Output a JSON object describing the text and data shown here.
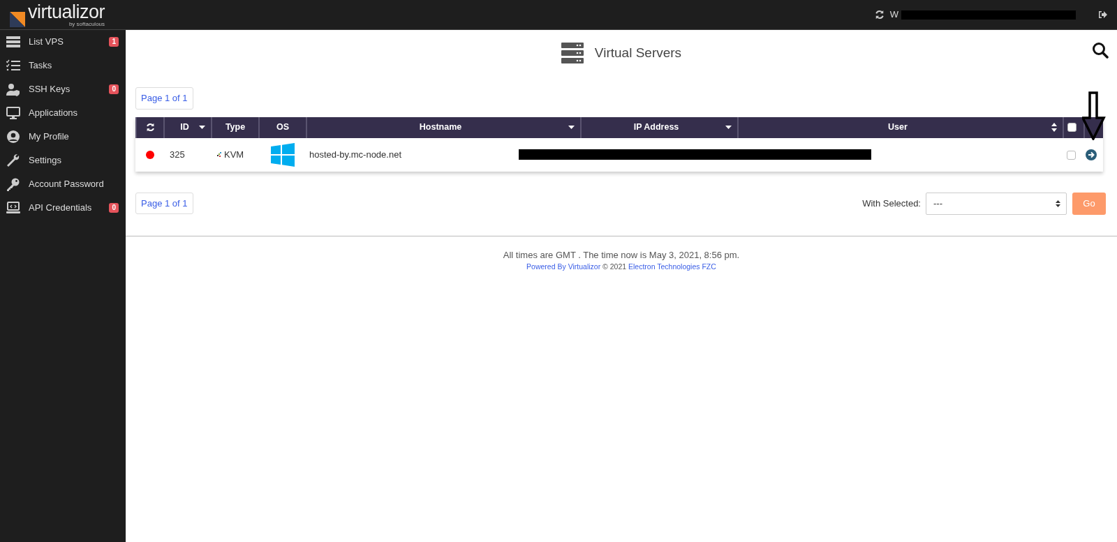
{
  "brand": {
    "name": "virtualizor",
    "tagline": "by softaculous"
  },
  "topbar": {
    "user_text": "W"
  },
  "sidebar": {
    "items": [
      {
        "label": "List VPS",
        "badge": "1"
      },
      {
        "label": "Tasks"
      },
      {
        "label": "SSH Keys",
        "badge": "0"
      },
      {
        "label": "Applications"
      },
      {
        "label": "My Profile"
      },
      {
        "label": "Settings"
      },
      {
        "label": "Account Password"
      },
      {
        "label": "API Credentials",
        "badge": "0"
      }
    ]
  },
  "page": {
    "title": "Virtual Servers"
  },
  "pagination_top": "Page 1 of 1",
  "table": {
    "columns": [
      {
        "kind": "refresh"
      },
      {
        "kind": "text",
        "label": "ID",
        "sort_menu": true
      },
      {
        "kind": "text",
        "label": "Type"
      },
      {
        "kind": "text",
        "label": "OS"
      },
      {
        "kind": "text",
        "label": "Hostname",
        "sort_menu": true
      },
      {
        "kind": "text",
        "label": "IP Address",
        "sort_menu": true
      },
      {
        "kind": "text",
        "label": "User",
        "sort_toggle": true
      },
      {
        "kind": "checkbox",
        "checked": false
      },
      {
        "kind": "blank"
      }
    ],
    "rows": [
      {
        "color": "#ff0000",
        "id": "325",
        "type": "KVM",
        "hostname": "hosted-by.mc-node.net",
        "checked": false
      }
    ]
  },
  "pagination_bottom": "Page 1 of 1",
  "bulk": {
    "label": "With Selected:",
    "value": "---",
    "button": "Go"
  },
  "footer": {
    "time_note": "All times are GMT . The time now is May 3, 2021, 8:56 pm.",
    "powered": "Powered By Virtualizor",
    "copyright": "© 2021",
    "company": "Electron Technologies FZC"
  }
}
